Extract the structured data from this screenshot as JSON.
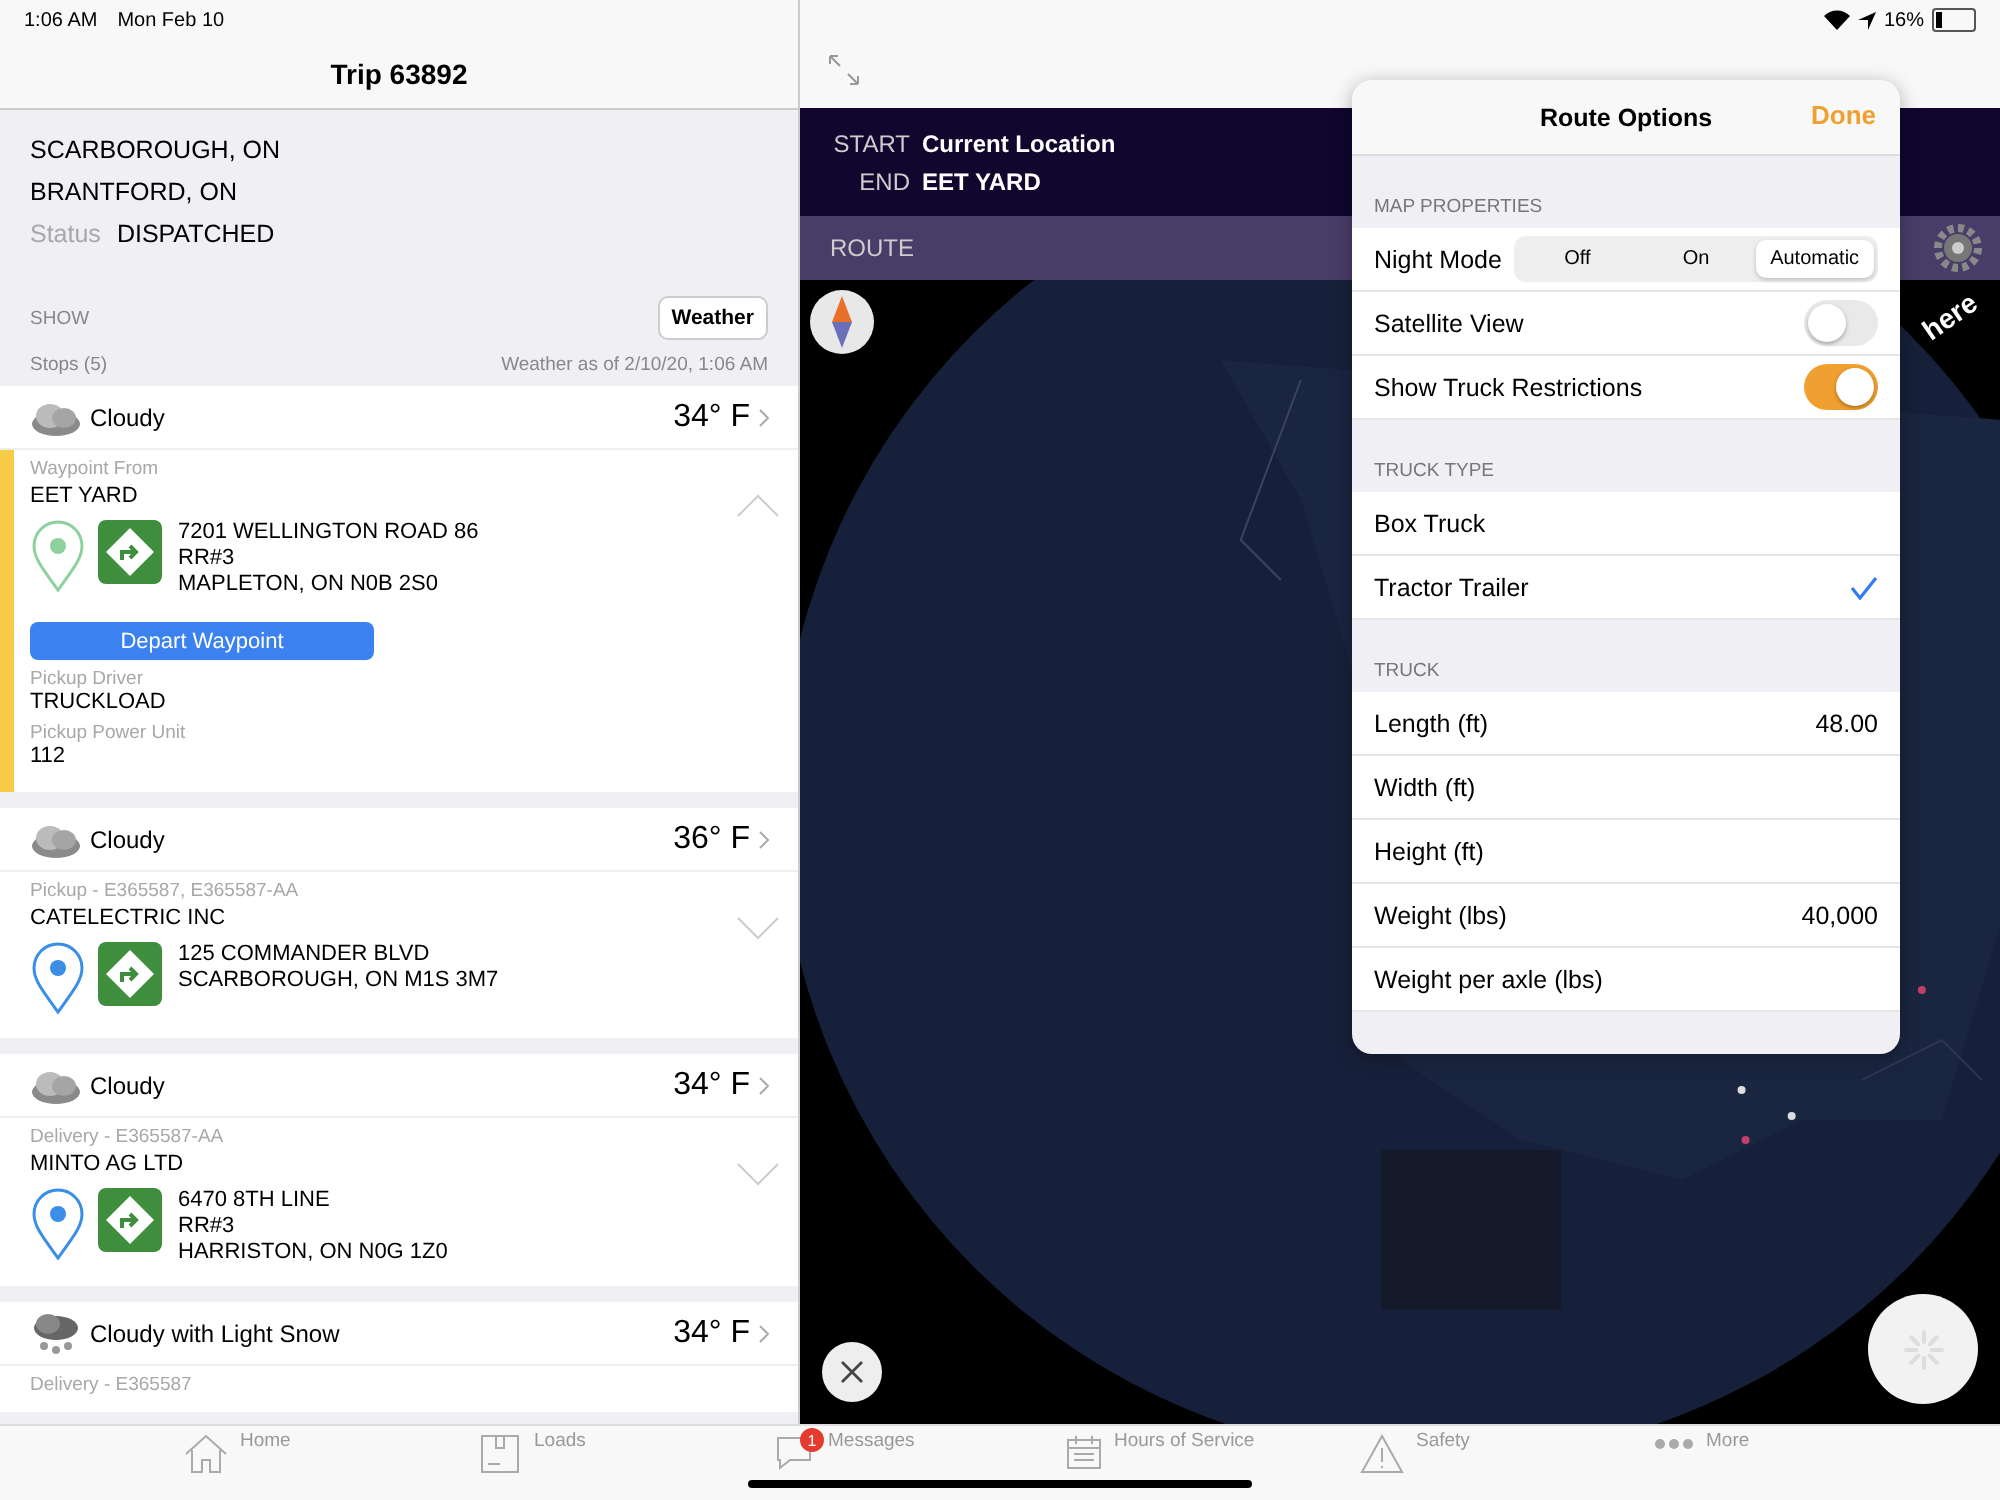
{
  "status_bar": {
    "time": "1:06 AM",
    "date": "Mon Feb 10",
    "battery": "16%"
  },
  "trip": {
    "title": "Trip 63892",
    "origin": "SCARBOROUGH, ON",
    "destination": "BRANTFORD, ON",
    "status_label": "Status",
    "status": "DISPATCHED",
    "show_label": "SHOW",
    "show_button": "Weather",
    "stops_label": "Stops (5)",
    "weather_time": "Weather as of 2/10/20, 1:06 AM"
  },
  "stops": [
    {
      "kind": "cloudy",
      "condition": "Cloudy",
      "temp": "34° F",
      "type": "Waypoint From",
      "name": "EET YARD",
      "color": "#8fd19e",
      "address": [
        "7201 WELLINGTON ROAD 86",
        "RR#3",
        "MAPLETON, ON N0B 2S0"
      ],
      "expanded": true,
      "highlighted": true,
      "action": "Depart Waypoint",
      "fields": [
        {
          "label": "Pickup Driver",
          "value": "TRUCKLOAD"
        },
        {
          "label": "Pickup Power Unit",
          "value": "112"
        }
      ]
    },
    {
      "kind": "cloudy",
      "condition": "Cloudy",
      "temp": "36° F",
      "type": "Pickup - E365587, E365587-AA",
      "name": "CATELECTRIC INC",
      "color": "#3a8ee6",
      "address": [
        "125 COMMANDER BLVD",
        "SCARBOROUGH, ON M1S 3M7"
      ],
      "expanded": false,
      "highlighted": false
    },
    {
      "kind": "cloudy",
      "condition": "Cloudy",
      "temp": "34° F",
      "type": "Delivery - E365587-AA",
      "name": "MINTO AG LTD",
      "color": "#3a8ee6",
      "address": [
        "6470 8TH LINE",
        "RR#3",
        "HARRISTON, ON N0G 1Z0"
      ],
      "expanded": false,
      "highlighted": false
    },
    {
      "kind": "snow",
      "condition": "Cloudy with Light Snow",
      "temp": "34° F",
      "type": "Delivery - E365587"
    }
  ],
  "route": {
    "start_label": "START",
    "start": "Current Location",
    "end_label": "END",
    "end": "EET YARD",
    "route_label": "ROUTE",
    "map_logo": "here"
  },
  "route_options": {
    "title": "Route Options",
    "done": "Done",
    "sections": [
      {
        "header": "MAP PROPERTIES",
        "rows": [
          {
            "kind": "segmented",
            "label": "Night Mode",
            "options": [
              {
                "label": "Off",
                "selected": false
              },
              {
                "label": "On",
                "selected": false
              },
              {
                "label": "Automatic",
                "selected": true
              }
            ]
          },
          {
            "kind": "toggle",
            "label": "Satellite View",
            "on": false
          },
          {
            "kind": "toggle",
            "label": "Show Truck Restrictions",
            "on": true
          }
        ]
      },
      {
        "header": "TRUCK TYPE",
        "rows": [
          {
            "kind": "choice",
            "label": "Box Truck",
            "selected": false
          },
          {
            "kind": "choice",
            "label": "Tractor Trailer",
            "selected": true
          }
        ]
      },
      {
        "header": "TRUCK",
        "rows": [
          {
            "kind": "value",
            "label": "Length (ft)",
            "value": "48.00"
          },
          {
            "kind": "value",
            "label": "Width (ft)"
          },
          {
            "kind": "value",
            "label": "Height (ft)"
          },
          {
            "kind": "value",
            "label": "Weight (lbs)",
            "value": "40,000"
          },
          {
            "kind": "value",
            "label": "Weight per axle (lbs)"
          }
        ]
      }
    ]
  },
  "tab_bar": [
    {
      "kind": "home",
      "label": "Home",
      "selected": false
    },
    {
      "kind": "box",
      "label": "Loads",
      "selected": false
    },
    {
      "kind": "chat",
      "label": "Messages",
      "badge": "1",
      "selected": false
    },
    {
      "kind": "calendar",
      "label": "Hours of Service",
      "selected": false
    },
    {
      "kind": "warning",
      "label": "Safety",
      "selected": false
    },
    {
      "kind": "more",
      "label": "More",
      "selected": false
    }
  ]
}
